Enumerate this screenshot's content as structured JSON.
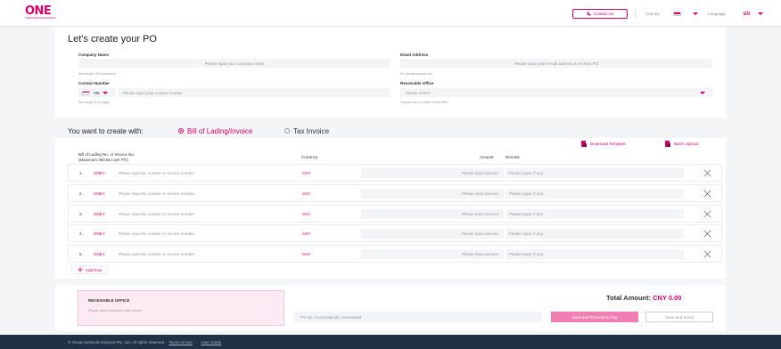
{
  "header": {
    "logo": "ONE",
    "logo_sub": "OCEAN NETWORK EXPRESS",
    "contact_label": "Contact Us",
    "country_label": "Country",
    "language_label": "Language",
    "language_value": "EN"
  },
  "form": {
    "title": "Let's create your PO",
    "company": {
      "label": "Company Name",
      "placeholder": "Please input your company name",
      "hint": "Max length 200 characters"
    },
    "email": {
      "label": "Email Address",
      "placeholder": "Please input your e-mail address to receive PO",
      "hint": "Ex: aaa@example.com"
    },
    "contact": {
      "label": "Contact Number",
      "code": "+86",
      "placeholder": "Please input your contact number",
      "hint": "Max length is 12 digits"
    },
    "office": {
      "label": "Receivable Office",
      "placeholder": "Please select",
      "hint": "Payment will be made to this office"
    }
  },
  "create_with": {
    "label": "You want to create with:",
    "option_bl": "Bill of Lading/Invoice",
    "option_tax": "Tax Invoice"
  },
  "tools": {
    "download": "Download Template",
    "upload": "Batch Upload"
  },
  "table": {
    "col_bl_1": "Bill of Lading No. or Invoice No.",
    "col_bl_2": "(Maximum 450 BLs per PO)",
    "col_currency": "Currency",
    "col_amount": "Amount",
    "col_remark": "Remark",
    "rows": [
      {
        "num": "1.",
        "prefix": "ONEY",
        "bl_placeholder": "Please input BL number or Invoice number",
        "currency": "CNY",
        "amount_placeholder": "Please input amount",
        "remark_placeholder": "Please input, if any"
      },
      {
        "num": "2.",
        "prefix": "ONEY",
        "bl_placeholder": "Please input BL number or Invoice number",
        "currency": "CNY",
        "amount_placeholder": "Please input amount",
        "remark_placeholder": "Please input, if any"
      },
      {
        "num": "3.",
        "prefix": "ONEY",
        "bl_placeholder": "Please input BL number or Invoice number",
        "currency": "CNY",
        "amount_placeholder": "Please input amount",
        "remark_placeholder": "Please input, if any"
      },
      {
        "num": "4.",
        "prefix": "ONEY",
        "bl_placeholder": "Please input BL number or Invoice number",
        "currency": "CNY",
        "amount_placeholder": "Please input amount",
        "remark_placeholder": "Please input, if any"
      },
      {
        "num": "5.",
        "prefix": "ONEY",
        "bl_placeholder": "Please input BL number or Invoice number",
        "currency": "CNY",
        "amount_placeholder": "Please input amount",
        "remark_placeholder": "Please input, if any"
      }
    ],
    "add_row": "Add Row"
  },
  "summary": {
    "office_title": "RECEIVABLE OFFICE",
    "office_sub": "(Please select receivable office above)",
    "total_label": "Total Amount:",
    "total_value": "CNY 0.00",
    "po_placeholder": "PO No. (Automatically Generated)",
    "proceed": "Save and Proceed to Pay",
    "save_email": "Save and Email"
  },
  "footer": {
    "copyright": "© Ocean Network Express Pte. Ltd. All rights reserved.",
    "terms": "Terms of Use",
    "sep": "·",
    "guide": "User Guide"
  },
  "colors": {
    "brand": "#d6006b",
    "footer": "#213145"
  }
}
